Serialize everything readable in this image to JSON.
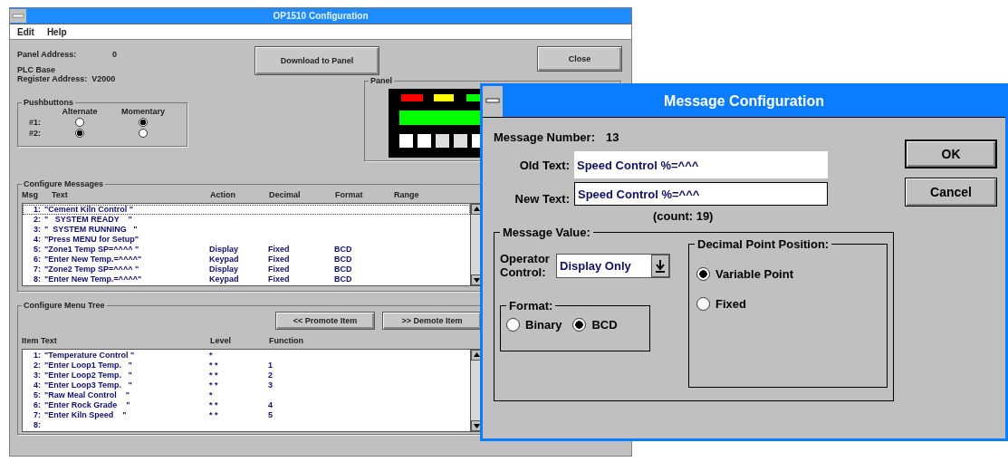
{
  "main_window": {
    "title": "OP1510 Configuration",
    "menu": [
      "Edit",
      "Help"
    ],
    "panel_address_label": "Panel Address:",
    "panel_address": "0",
    "plc_base_label": "PLC Base",
    "register_address_label": "Register Address:",
    "register_address": "V2000",
    "download_button": "Download to Panel",
    "close_button": "Close",
    "pushbuttons": {
      "title": "Pushbuttons",
      "columns": [
        "Alternate",
        "Momentary"
      ],
      "rows": [
        {
          "label": "#1:",
          "options": [
            {
              "selected": false
            },
            {
              "selected": true
            }
          ]
        },
        {
          "label": "#2:",
          "options": [
            {
              "selected": true
            },
            {
              "selected": false
            }
          ]
        }
      ]
    },
    "panel": {
      "title": "Panel"
    },
    "messages": {
      "title": "Configure Messages",
      "columns": [
        "Msg",
        "Text",
        "Action",
        "Decimal",
        "Format",
        "Range"
      ],
      "rows": [
        {
          "number": "1:",
          "text": "\"Cement Kiln Control \"",
          "selected": true
        },
        {
          "number": "2:",
          "text": "\"   SYSTEM READY    \"",
          "selected": false
        },
        {
          "number": "3:",
          "text": "\"  SYSTEM RUNNING   \"",
          "selected": false
        },
        {
          "number": "4:",
          "text": "\"Press MENU for Setup\"",
          "selected": false
        },
        {
          "number": "5:",
          "text": "\"Zone1 Temp SP=^^^^ \"",
          "action": "Display",
          "decimal": "Fixed",
          "format": "BCD",
          "selected": false
        },
        {
          "number": "6:",
          "text": "\"Enter New Temp.=^^^^\"",
          "action": "Keypad",
          "decimal": "Fixed",
          "format": "BCD",
          "selected": false
        },
        {
          "number": "7:",
          "text": "\"Zone2 Temp SP=^^^^ \"",
          "action": "Display",
          "decimal": "Fixed",
          "format": "BCD",
          "selected": false
        },
        {
          "number": "8:",
          "text": "\"Enter New Temp.=^^^^\"",
          "action": "Keypad",
          "decimal": "Fixed",
          "format": "BCD",
          "selected": false
        }
      ]
    },
    "menu_tree": {
      "title": "Configure Menu Tree",
      "buttons": [
        "<< Promote Item",
        ">> Demote Item"
      ],
      "columns": [
        "Item Text",
        "Level",
        "Function"
      ],
      "rows": [
        {
          "number": "1:",
          "text": "\"Temperature Control \"",
          "level": "*"
        },
        {
          "number": "2:",
          "text": "\"Enter Loop1 Temp.   \"",
          "level": "* *",
          "function": "1"
        },
        {
          "number": "3:",
          "text": "\"Enter Loop2 Temp.   \"",
          "level": "* *",
          "function": "2"
        },
        {
          "number": "4:",
          "text": "\"Enter Loop3 Temp.   \"",
          "level": "* *",
          "function": "3"
        },
        {
          "number": "5:",
          "text": "\"Raw Meal Control    \"",
          "level": "*"
        },
        {
          "number": "6:",
          "text": "\"Enter Rock Grade    \"",
          "level": "* *",
          "function": "4"
        },
        {
          "number": "7:",
          "text": "\"Enter Kiln Speed    \"",
          "level": "* *",
          "function": "5"
        },
        {
          "number": "8:"
        }
      ]
    }
  },
  "dialog": {
    "title": "Message Configuration",
    "message_number_label": "Message Number:",
    "message_number": "13",
    "old_text_label": "Old Text:",
    "old_text": "Speed Control %=^^^",
    "new_text_label": "New Text:",
    "new_text": "Speed Control %=^^^",
    "count": "(count: 19)",
    "buttons": [
      {
        "label": "OK",
        "default": true
      },
      {
        "label": "Cancel",
        "default": false
      }
    ],
    "message_value": {
      "title": "Message Value:",
      "operator_control_label": "Operator Control:",
      "operator_control": "Display Only",
      "format": {
        "title": "Format:",
        "options": [
          {
            "label": "Binary",
            "selected": false
          },
          {
            "label": "BCD",
            "selected": true
          }
        ]
      },
      "decimal_point": {
        "title": "Decimal Point Position:",
        "options": [
          {
            "label": "Variable Point",
            "selected": true
          },
          {
            "label": "Fixed",
            "selected": false
          }
        ]
      }
    }
  }
}
